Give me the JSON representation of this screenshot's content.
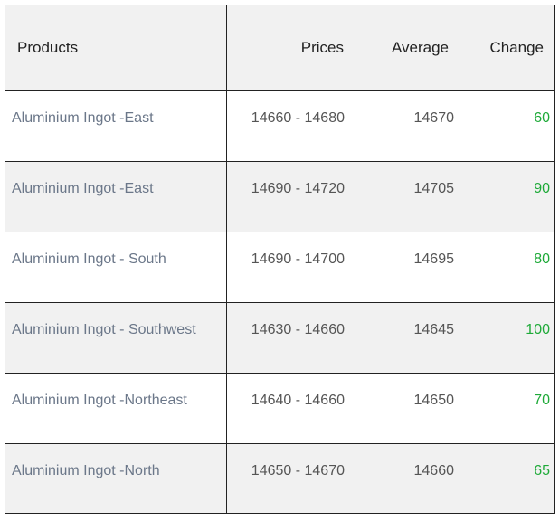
{
  "table": {
    "headers": {
      "products": "Products",
      "prices": "Prices",
      "average": "Average",
      "change": "Change"
    },
    "rows": [
      {
        "product": "Aluminium Ingot -East",
        "prices": "14660 - 14680",
        "average": "14670",
        "change": "60"
      },
      {
        "product": "Aluminium Ingot -East",
        "prices": "14690 - 14720",
        "average": "14705",
        "change": "90"
      },
      {
        "product": "Aluminium Ingot - South",
        "prices": "14690 - 14700",
        "average": "14695",
        "change": "80"
      },
      {
        "product": "Aluminium Ingot - Southwest",
        "prices": "14630 - 14660",
        "average": "14645",
        "change": "100"
      },
      {
        "product": "Aluminium Ingot -Northeast",
        "prices": "14640 - 14660",
        "average": "14650",
        "change": "70"
      },
      {
        "product": "Aluminium Ingot -North",
        "prices": "14650 - 14670",
        "average": "14660",
        "change": "65"
      }
    ]
  },
  "colors": {
    "header_bg": "#f1f1f1",
    "product_text": "#6b7789",
    "change_positive": "#1faa39",
    "border": "#222222"
  }
}
